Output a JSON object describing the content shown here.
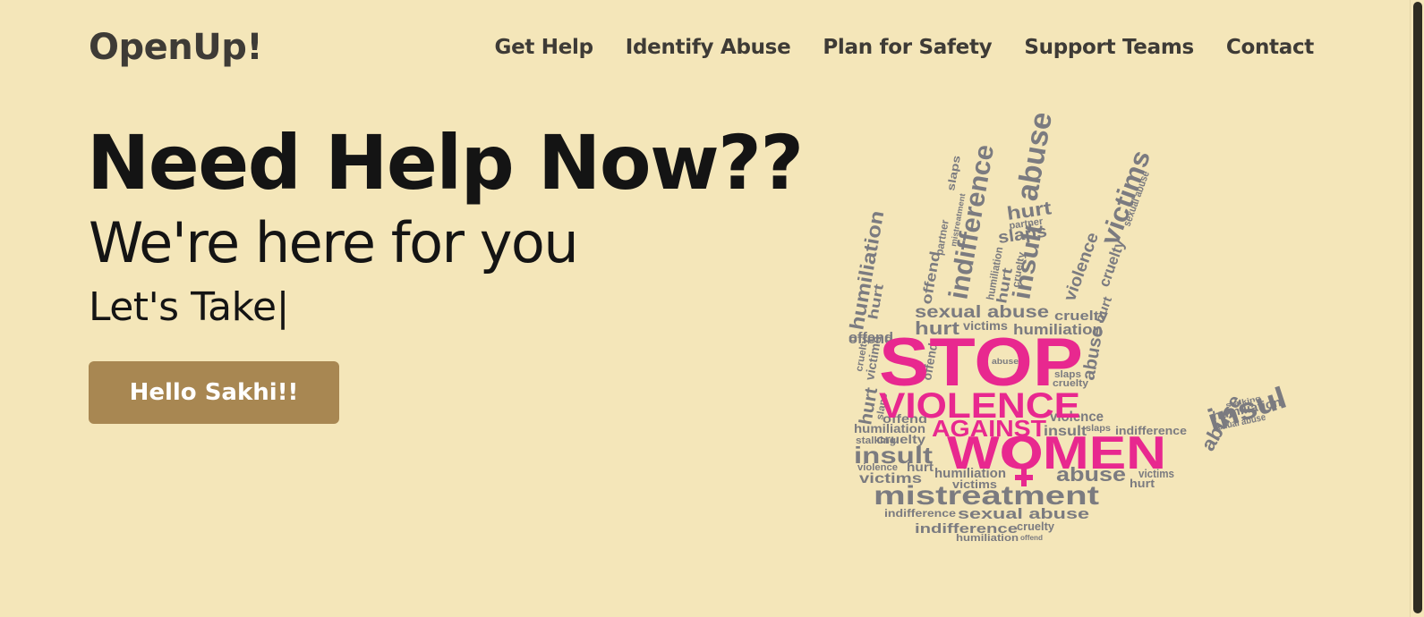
{
  "brand": {
    "name": "OpenUp!"
  },
  "nav": {
    "items": [
      "Get Help",
      "Identify Abuse",
      "Plan for Safety",
      "Support Teams",
      "Contact"
    ]
  },
  "hero": {
    "title": "Need Help Now??",
    "subtitle": "We're here for you",
    "typed_text": "Let's Take",
    "cursor": "|",
    "cta_label": "Hello Sakhi!!"
  },
  "illustration": {
    "headline": [
      "STOP",
      "VIOLENCE",
      "AGAINST",
      "WOMEN"
    ],
    "words": {
      "thumb": [
        "humiliation",
        "hurt",
        "offend",
        "cruelty",
        "victims",
        "hurt",
        "slaps",
        "offend"
      ],
      "index": [
        "indifference",
        "offend",
        "partner",
        "mistreatment",
        "slaps"
      ],
      "middle": [
        "abuse",
        "hurt",
        "partner",
        "slaps",
        "insult",
        "humiliation",
        "hurt",
        "cruelty"
      ],
      "ring": [
        "victims",
        "violence",
        "cruelty",
        "hurt",
        "sexual abuse"
      ],
      "palm": [
        "sexual abuse",
        "cruelty",
        "hurt",
        "victims",
        "humiliation",
        "offend",
        "abuse",
        "slaps",
        "cruelty",
        "abuse",
        "violence",
        "offend",
        "insult",
        "slaps",
        "indifference",
        "humiliation",
        "cruelty",
        "insult",
        "violence",
        "hurt",
        "victims",
        "humiliation",
        "victims",
        "abuse",
        "mistreatment",
        "indifference",
        "sexual abuse",
        "indifference",
        "cruelty",
        "humiliation",
        "offend",
        "stalking",
        "hurt",
        "victims",
        "abuse",
        "insul",
        "humiliation",
        "sexual abuse",
        "stalking"
      ]
    },
    "colors": {
      "headline": "#e8288f",
      "words": "#7b7b80"
    }
  },
  "colors": {
    "background": "#f4e6b9",
    "button": "#a88752",
    "text": "#141414",
    "nav": "#3e3b36"
  }
}
